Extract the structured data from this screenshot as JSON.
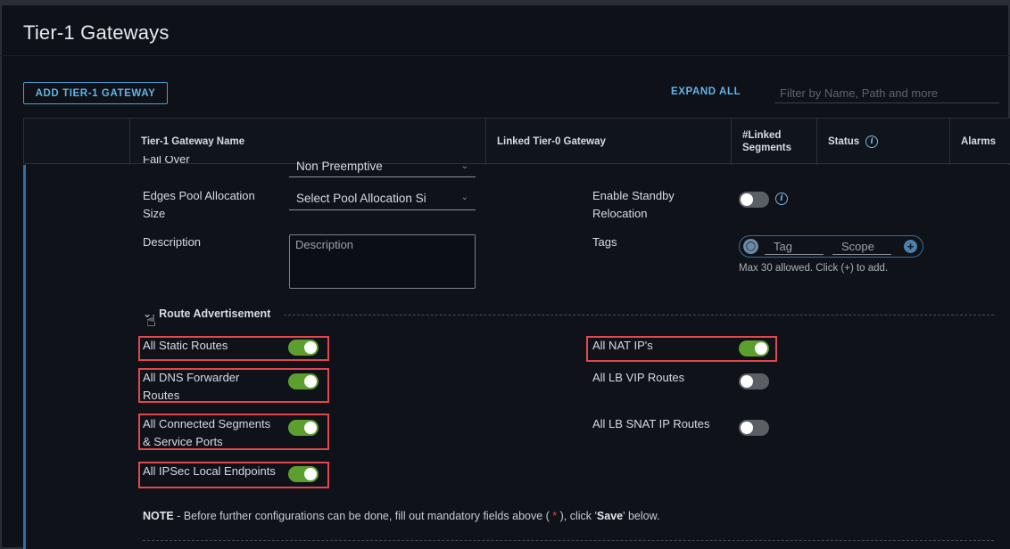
{
  "page_title": "Tier-1 Gateways",
  "toolbar": {
    "add_label": "ADD TIER-1 GATEWAY",
    "expand_all_label": "EXPAND ALL",
    "filter_placeholder": "Filter by Name, Path and more"
  },
  "table": {
    "columns": [
      {
        "label": "Tier-1 Gateway Name"
      },
      {
        "label": "Linked Tier-0 Gateway"
      },
      {
        "label": "#Linked Segments"
      },
      {
        "label": "Status"
      },
      {
        "label": "Alarms"
      }
    ]
  },
  "form": {
    "fail_over": {
      "label": "Fail Over",
      "value": "Non Preemptive"
    },
    "edges_pool": {
      "label": "Edges Pool Allocation Size",
      "value": "Select Pool Allocation Si"
    },
    "description": {
      "label": "Description",
      "placeholder": "Description"
    },
    "enable_standby": {
      "label": "Enable Standby Relocation",
      "enabled": false
    },
    "tags": {
      "label": "Tags",
      "tag_placeholder": "Tag",
      "scope_placeholder": "Scope",
      "hint": "Max 30 allowed. Click (+) to add."
    }
  },
  "route_advertisement": {
    "title": "Route Advertisement",
    "left": [
      {
        "label": "All Static Routes",
        "enabled": true
      },
      {
        "label": "All DNS Forwarder Routes",
        "enabled": true
      },
      {
        "label": "All Connected Segments & Service Ports",
        "enabled": true
      },
      {
        "label": "All IPSec Local Endpoints",
        "enabled": true
      }
    ],
    "right": [
      {
        "label": "All NAT IP's",
        "enabled": true
      },
      {
        "label": "All LB VIP Routes",
        "enabled": false
      },
      {
        "label": "All LB SNAT IP Routes",
        "enabled": false
      }
    ]
  },
  "note": {
    "prefix": "NOTE",
    "text_before": " - Before further configurations can be done, fill out mandatory fields above ( ",
    "asterisk": "*",
    "text_middle": " ), click '",
    "save": "Save",
    "text_after": "' below."
  },
  "colors": {
    "accent": "#62b4e6",
    "toggle_on": "#5d9f2f",
    "toggle_off": "#5a5f66",
    "highlight": "#e0484b"
  }
}
